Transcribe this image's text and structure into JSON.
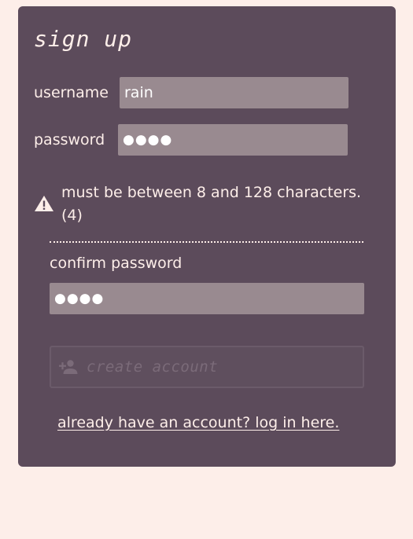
{
  "form": {
    "title": "sign up",
    "username_label": "username",
    "username_value": "rain",
    "password_label": "password",
    "password_value": "●●●●",
    "warning_text": "must be between 8 and 128 characters. (4)",
    "confirm_label": "confirm password",
    "confirm_value": "●●●●",
    "create_button_label": "create account",
    "login_link_text": "already have an account? log in here."
  },
  "icons": {
    "warning": "warning-triangle-icon",
    "create": "add-user-icon"
  },
  "colors": {
    "page_background": "#fdeee9",
    "card_background": "#5c4b5b",
    "field_background": "#998a90",
    "text": "#fdeee9",
    "disabled_text": "#7b6b79"
  }
}
